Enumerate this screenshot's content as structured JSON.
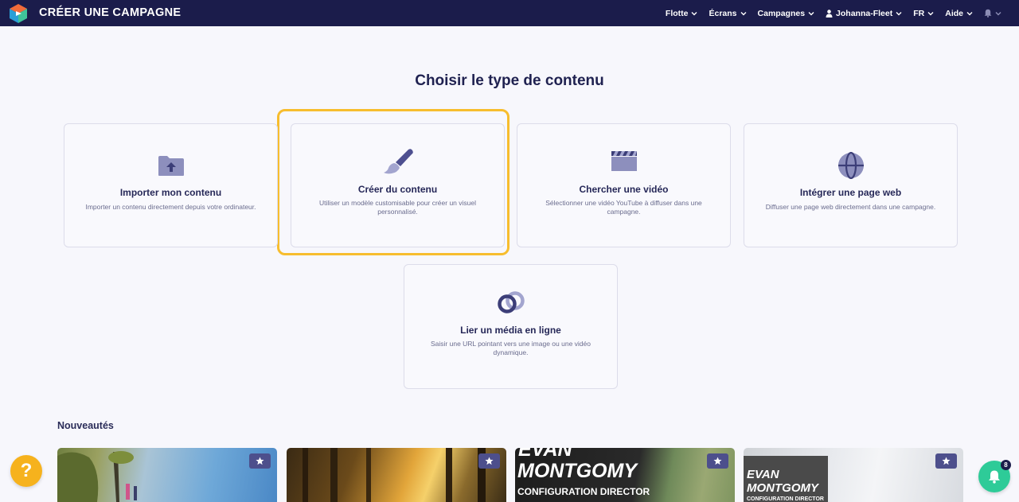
{
  "header": {
    "app_title": "CRÉER UNE CAMPAGNE",
    "nav": {
      "flotte": "Flotte",
      "ecrans": "Écrans",
      "campagnes": "Campagnes",
      "user": "Johanna-Fleet",
      "lang": "FR",
      "aide": "Aide"
    }
  },
  "main": {
    "title": "Choisir le type de contenu",
    "options": [
      {
        "title": "Importer mon contenu",
        "desc": "Importer un contenu directement depuis votre ordinateur.",
        "icon": "folder-upload-icon"
      },
      {
        "title": "Créer du contenu",
        "desc": "Utiliser un modèle customisable pour créer un visuel personnalisé.",
        "icon": "paint-brush-icon"
      },
      {
        "title": "Chercher une vidéo",
        "desc": "Sélectionner une vidéo YouTube à diffuser dans une campagne.",
        "icon": "clapperboard-icon"
      },
      {
        "title": "Intégrer une page web",
        "desc": "Diffuser une page web directement dans une campagne.",
        "icon": "globe-icon"
      },
      {
        "title": "Lier un média en ligne",
        "desc": "Saisir une URL pointant vers une image ou une vidéo dynamique.",
        "icon": "link-icon"
      }
    ],
    "selected_option": "Créer du contenu"
  },
  "news": {
    "title": "Nouveautés",
    "thumb3_line1": "EVAN",
    "thumb3_line2": "MONTGOMY",
    "thumb3_line3": "CONFIGURATION DIRECTOR",
    "thumb4_line1": "EVAN",
    "thumb4_line2": "MONTGOMY",
    "thumb4_line3": "CONFIGURATION DIRECTOR"
  },
  "floating": {
    "help_label": "?",
    "notif_count": "8"
  },
  "colors": {
    "topbar": "#1b1c4b",
    "accent_highlight": "#f7bd2e",
    "icon": "#5a5c98",
    "help": "#f6b21d",
    "notif": "#2ecb98"
  }
}
